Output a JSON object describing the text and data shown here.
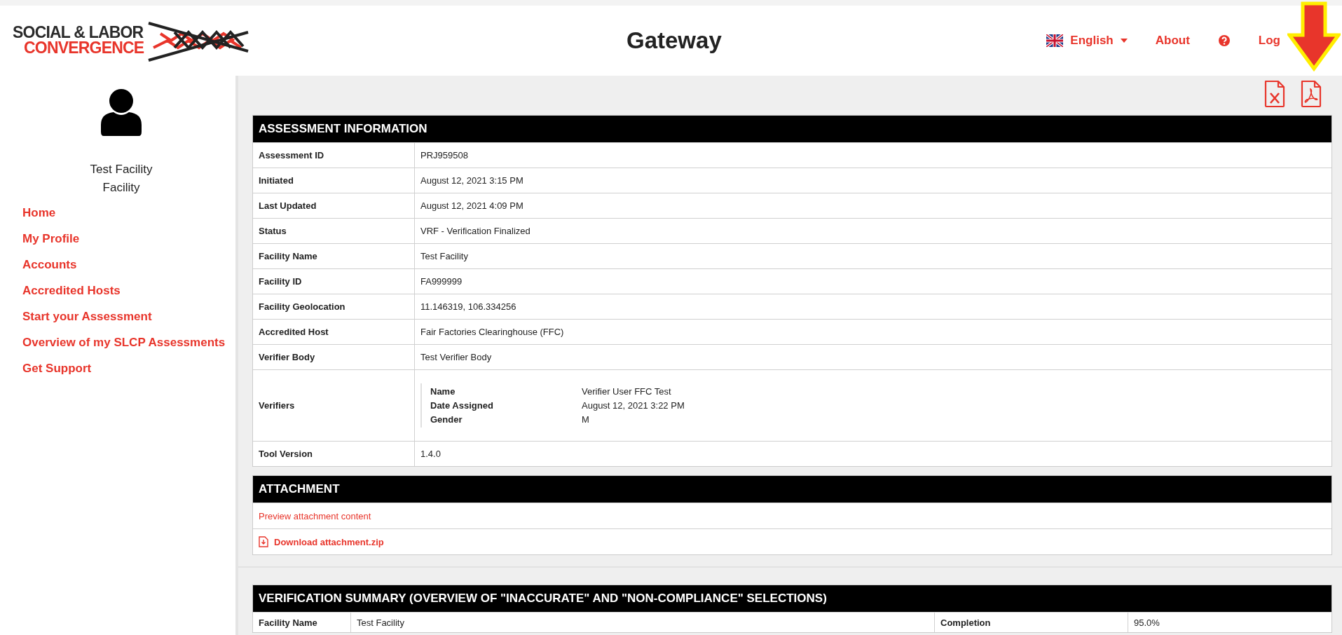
{
  "header": {
    "logo": {
      "line_1": "SOCIAL & LABOR",
      "line_2": "CONVERGENCE"
    },
    "title": "Gateway",
    "nav": [
      {
        "kind": "language",
        "label": "English"
      },
      {
        "kind": "link",
        "label": "About"
      },
      {
        "kind": "help"
      },
      {
        "kind": "link",
        "label": "Log"
      }
    ]
  },
  "sidebar": {
    "user_name": "Test Facility",
    "user_role": "Facility",
    "items": [
      {
        "label": "Home"
      },
      {
        "label": "My Profile"
      },
      {
        "label": "Accounts"
      },
      {
        "label": "Accredited Hosts"
      },
      {
        "label": "Start your Assessment"
      },
      {
        "label": "Overview of my SLCP Assessments"
      },
      {
        "label": "Get Support"
      }
    ]
  },
  "export_buttons": [
    {
      "kind": "excel"
    },
    {
      "kind": "pdf"
    }
  ],
  "assessment_information": {
    "title": "ASSESSMENT INFORMATION",
    "rows": [
      {
        "label": "Assessment ID",
        "value": "PRJ959508"
      },
      {
        "label": "Initiated",
        "value": "August 12, 2021 3:15 PM"
      },
      {
        "label": "Last Updated",
        "value": "August 12, 2021 4:09 PM"
      },
      {
        "label": "Status",
        "value": "VRF - Verification Finalized"
      },
      {
        "label": "Facility Name",
        "value": "Test Facility"
      },
      {
        "label": "Facility ID",
        "value": "FA999999"
      },
      {
        "label": "Facility Geolocation",
        "value": "11.146319, 106.334256"
      },
      {
        "label": "Accredited Host",
        "value": "Fair Factories Clearinghouse (FFC)"
      },
      {
        "label": "Verifier Body",
        "value": "Test Verifier Body"
      },
      {
        "label": "Verifiers",
        "fields": [
          {
            "label": "Name",
            "value": "Verifier User FFC Test"
          },
          {
            "label": "Date Assigned",
            "value": "August 12, 2021 3:22 PM"
          },
          {
            "label": "Gender",
            "value": "M"
          }
        ]
      },
      {
        "label": "Tool Version",
        "value": "1.4.0"
      }
    ]
  },
  "attachment": {
    "title": "ATTACHMENT",
    "preview_link": "Preview attachment content",
    "download_link": "Download attachment.zip"
  },
  "verification_summary": {
    "title": "VERIFICATION SUMMARY (OVERVIEW OF \"INACCURATE\" AND \"NON-COMPLIANCE\" SELECTIONS)",
    "row": {
      "label_1": "Facility Name",
      "value_1": "Test Facility",
      "label_2": "Completion",
      "value_2": "95.0%"
    }
  }
}
